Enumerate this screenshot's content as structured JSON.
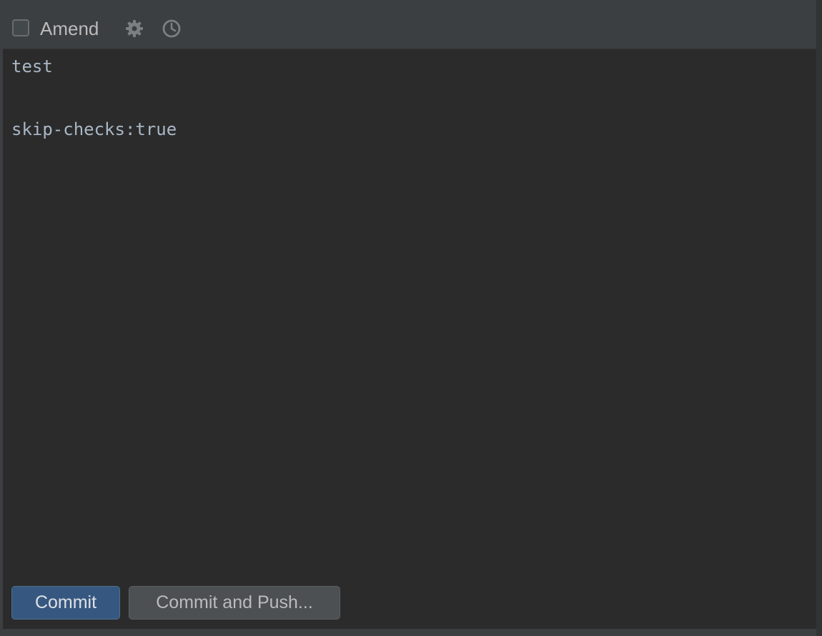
{
  "toolbar": {
    "amend_label": "Amend",
    "amend_checked": false,
    "icons": [
      "gear-icon",
      "clock-icon"
    ]
  },
  "editor": {
    "lines": [
      "test",
      "",
      "skip-checks:true"
    ]
  },
  "buttons": {
    "commit_label": "Commit",
    "commit_push_label": "Commit and Push..."
  },
  "colors": {
    "accent": "#365880",
    "panel": "#3c3f41",
    "editor_bg": "#2b2b2b",
    "editor_text": "#a9b7c6"
  }
}
